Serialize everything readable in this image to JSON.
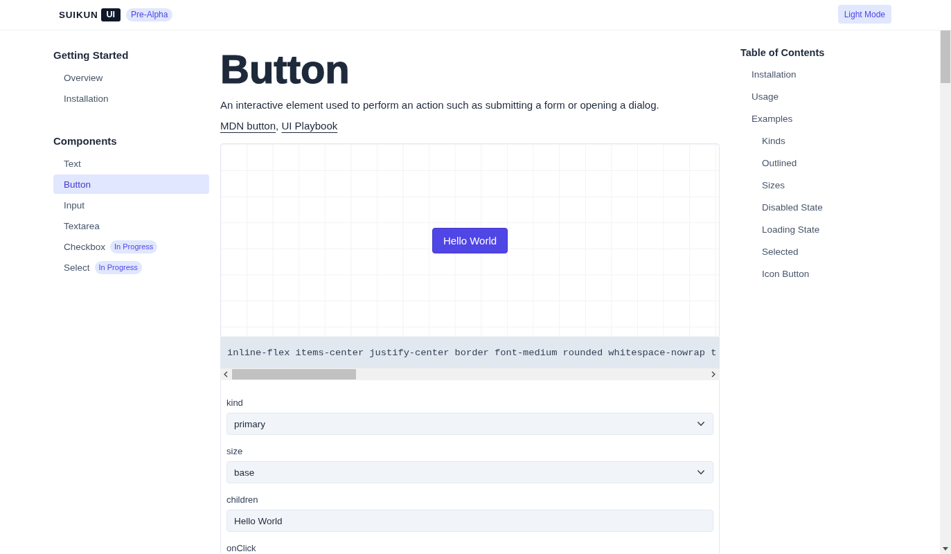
{
  "header": {
    "logo": "SUIKUN",
    "logo_tile": "UI",
    "stage_badge": "Pre-Alpha",
    "theme_button": "Light Mode"
  },
  "sidebar": {
    "sections": [
      {
        "title": "Getting Started",
        "items": [
          {
            "label": "Overview",
            "selected": false
          },
          {
            "label": "Installation",
            "selected": false
          }
        ]
      },
      {
        "title": "Components",
        "items": [
          {
            "label": "Text",
            "selected": false
          },
          {
            "label": "Button",
            "selected": true
          },
          {
            "label": "Input",
            "selected": false
          },
          {
            "label": "Textarea",
            "selected": false
          },
          {
            "label": "Checkbox",
            "selected": false,
            "badge": "In Progress"
          },
          {
            "label": "Select",
            "selected": false,
            "badge": "In Progress"
          }
        ]
      }
    ]
  },
  "main": {
    "title": "Button",
    "description": "An interactive element used to perform an action such as submitting a form or opening a dialog.",
    "links": {
      "items": [
        "MDN button",
        "UI Playbook"
      ],
      "separator": ","
    },
    "preview": {
      "button_label": "Hello World"
    },
    "class_list": "inline-flex items-center justify-center border font-medium rounded whitespace-nowrap t",
    "controls": [
      {
        "label": "kind",
        "kind": "select",
        "value": "primary"
      },
      {
        "label": "size",
        "kind": "select",
        "value": "base"
      },
      {
        "label": "children",
        "kind": "text",
        "value": "Hello World"
      },
      {
        "label": "onClick"
      }
    ]
  },
  "toc": {
    "title": "Table of Contents",
    "items": [
      {
        "label": "Installation"
      },
      {
        "label": "Usage"
      },
      {
        "label": "Examples",
        "children": [
          {
            "label": "Kinds"
          },
          {
            "label": "Outlined"
          },
          {
            "label": "Sizes"
          },
          {
            "label": "Disabled State"
          },
          {
            "label": "Loading State"
          },
          {
            "label": "Selected"
          },
          {
            "label": "Icon Button"
          }
        ]
      }
    ]
  }
}
